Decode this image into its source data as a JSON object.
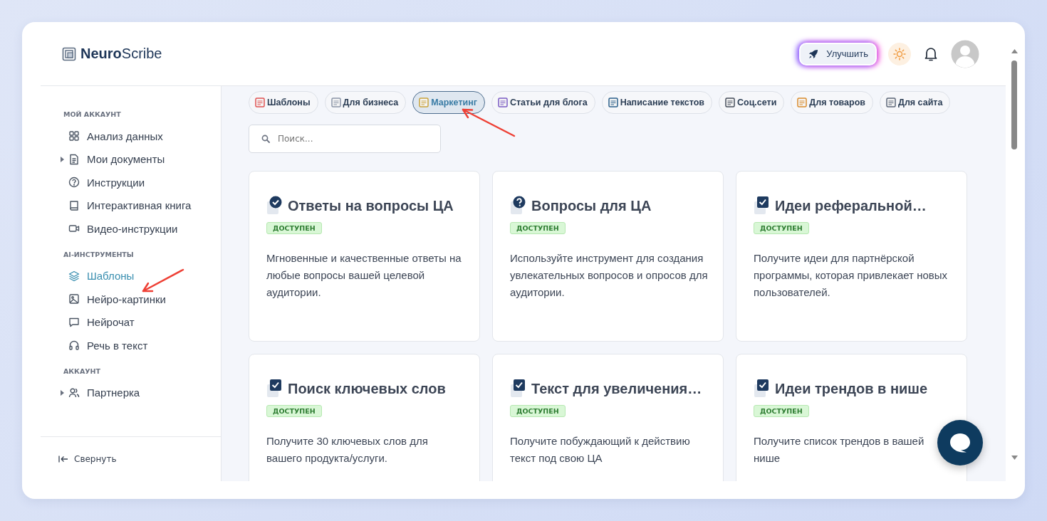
{
  "header": {
    "logo": "**Neuro**Scribe",
    "upgrade_button": "Улучшить"
  },
  "sidebar": {
    "sections": [
      {
        "title": "МОЙ АККАУНТ",
        "items": [
          {
            "label": "Анализ данных",
            "expandable": false,
            "selected": false
          },
          {
            "label": "Мои документы",
            "expandable": true,
            "selected": false
          },
          {
            "label": "Инструкции",
            "expandable": false,
            "selected": false
          },
          {
            "label": "Интерактивная книга",
            "expandable": false,
            "selected": false
          },
          {
            "label": "Видео-инструкции",
            "expandable": false,
            "selected": false
          }
        ]
      },
      {
        "title": "AI-ИНСТРУМЕНТЫ",
        "items": [
          {
            "label": "Шаблоны",
            "expandable": false,
            "selected": true
          },
          {
            "label": "Нейро-картинки",
            "expandable": false,
            "selected": false
          },
          {
            "label": "Нейрочат",
            "expandable": false,
            "selected": false
          },
          {
            "label": "Речь в текст",
            "expandable": false,
            "selected": false
          }
        ]
      },
      {
        "title": "АККАУНТ",
        "items": [
          {
            "label": "Партнерка",
            "expandable": true,
            "selected": false
          }
        ]
      }
    ],
    "collapse": "Свернуть"
  },
  "categories": [
    {
      "label": "Шаблоны",
      "selected": false
    },
    {
      "label": "Для бизнеса",
      "selected": false
    },
    {
      "label": "Маркетинг",
      "selected": true
    },
    {
      "label": "Статьи для блога",
      "selected": false
    },
    {
      "label": "Написание текстов",
      "selected": false
    },
    {
      "label": "Соц.сети",
      "selected": false
    },
    {
      "label": "Для товаров",
      "selected": false
    },
    {
      "label": "Для сайта",
      "selected": false
    }
  ],
  "search": {
    "placeholder": "Поиск..."
  },
  "cards": [
    {
      "title": "Ответы на вопросы ЦА",
      "badge": "ДОСТУПЕН",
      "description": "Мгновенные и качественные ответы на любые вопросы вашей целевой аудитории."
    },
    {
      "title": "Вопросы для ЦА",
      "badge": "ДОСТУПЕН",
      "description": "Используйте инструмент для создания увлекательных вопросов и опросов для аудитории."
    },
    {
      "title": "Идеи реферальной…",
      "badge": "ДОСТУПЕН",
      "description": "Получите идеи для партнёрской программы, которая привлекает новых пользователей."
    },
    {
      "title": "Поиск ключевых слов",
      "badge": "ДОСТУПЕН",
      "description": "Получите 30 ключевых слов для вашего продукта/услуги."
    },
    {
      "title": "Текст для увеличения…",
      "badge": "ДОСТУПЕН",
      "description": "Получите побуждающий к действию текст под свою ЦА"
    },
    {
      "title": "Идеи трендов в нише",
      "badge": "ДОСТУПЕН",
      "description": "Получите список трендов в вашей нише"
    }
  ]
}
